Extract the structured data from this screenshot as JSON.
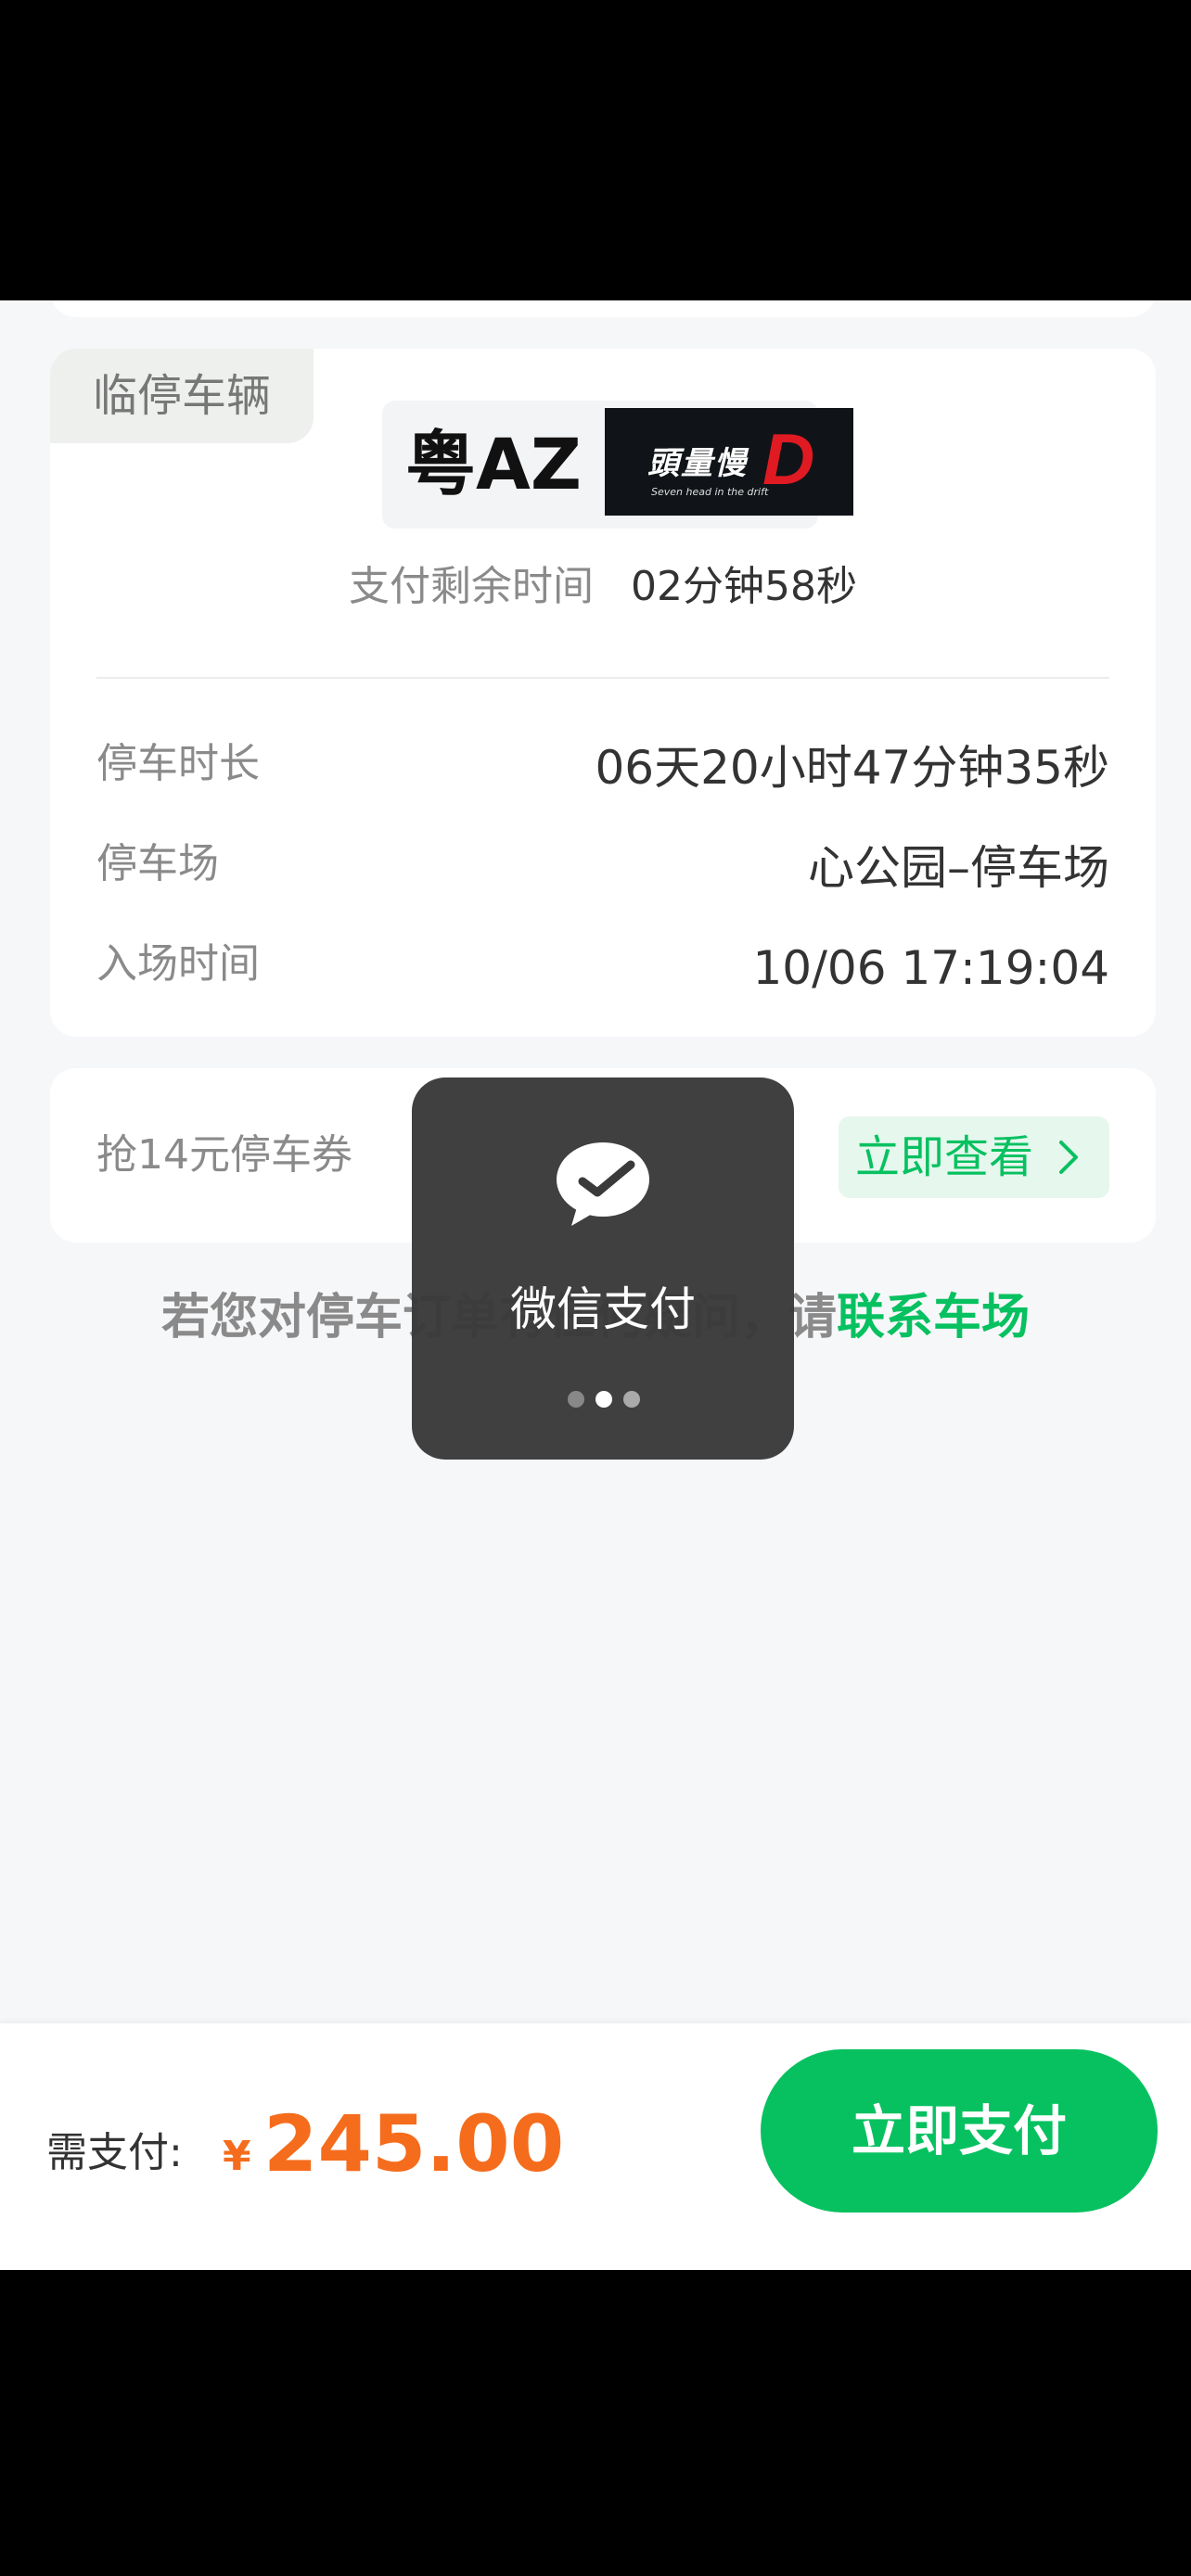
{
  "vehicle": {
    "tag": "临停车辆",
    "plate": "粤AZ",
    "plate_logo_main": "頭量慢",
    "plate_logo_letter": "D",
    "plate_logo_sub": "Seven head in the drift"
  },
  "countdown": {
    "label": "支付剩余时间",
    "value": "02分钟58秒"
  },
  "details": [
    {
      "label": "停车时长",
      "value": "06天20小时47分钟35秒"
    },
    {
      "label": "停车场",
      "value": "心公园–停车场"
    },
    {
      "label": "入场时间",
      "value": "10/06 17:19:04"
    }
  ],
  "coupon": {
    "text": "抢14元停车券",
    "button": "立即查看"
  },
  "question": {
    "text": "若您对停车订单有任何疑问，请",
    "link": "联系车场"
  },
  "payment": {
    "label": "需支付:",
    "currency": "¥",
    "amount": "245.00",
    "button": "立即支付"
  },
  "toast": {
    "title": "微信支付",
    "active_dot": 2,
    "dot_count": 3
  },
  "colors": {
    "accent": "#07c160",
    "price": "#f56c1c",
    "background": "#f6f7f9"
  }
}
